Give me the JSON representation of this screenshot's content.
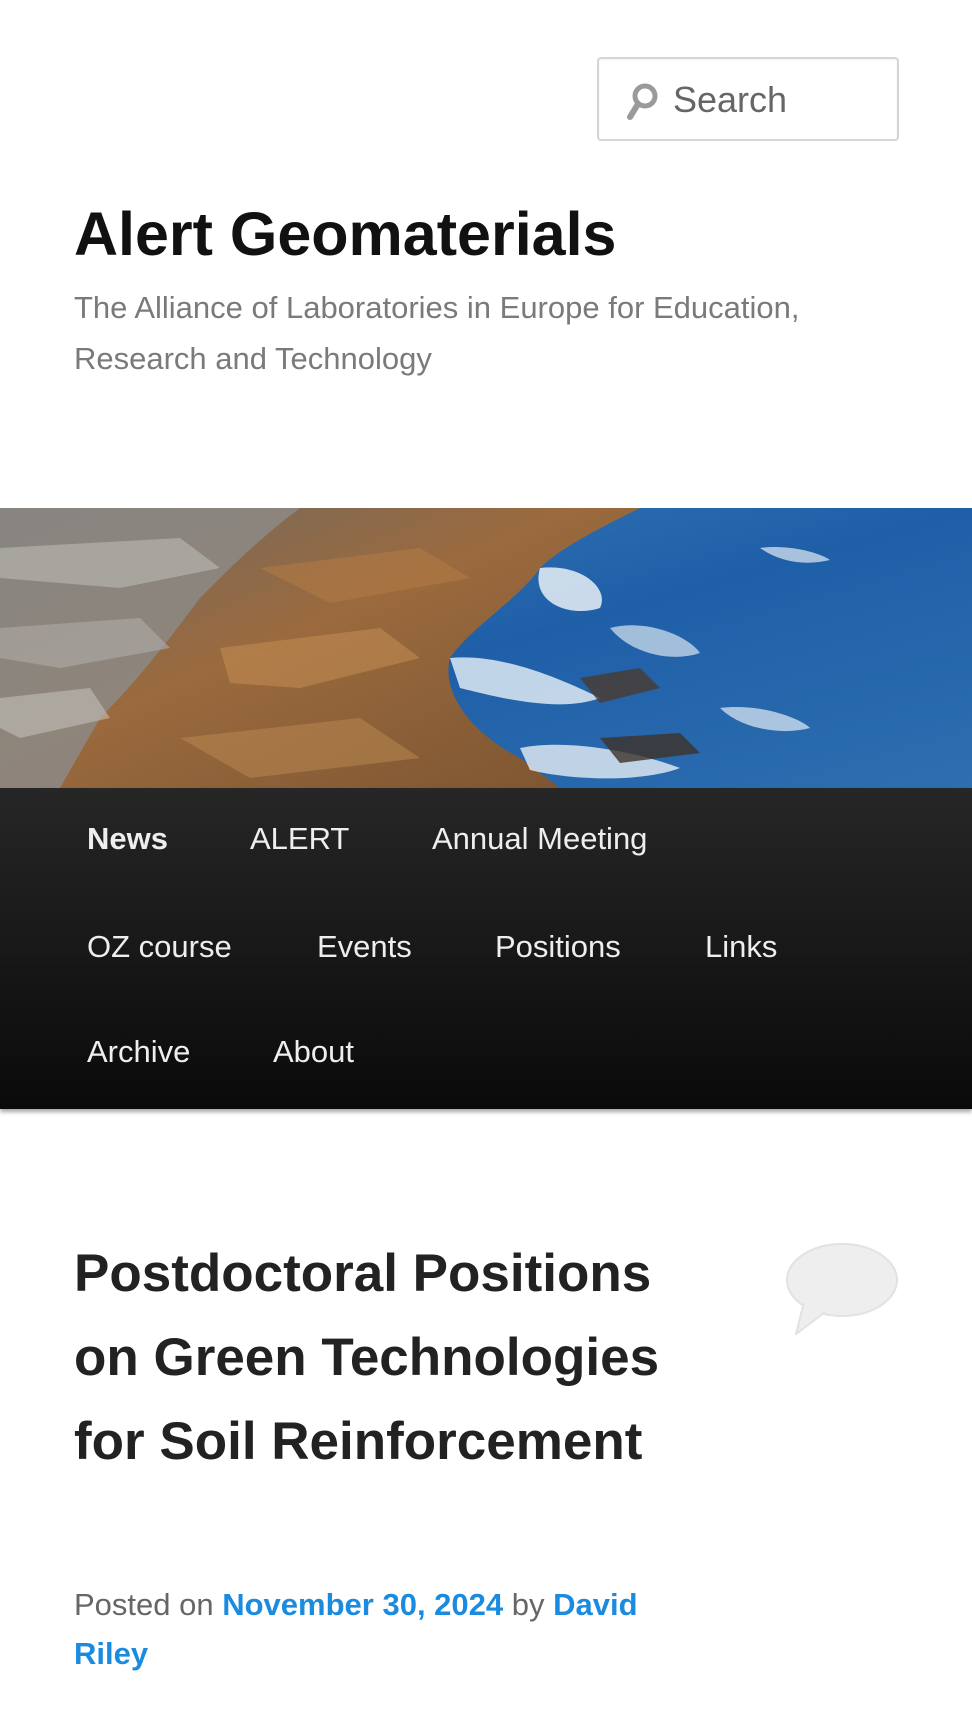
{
  "search": {
    "placeholder": "Search"
  },
  "site": {
    "title": "Alert Geomaterials",
    "description": "The Alliance of Laboratories in Europe for Education, Research and Technology"
  },
  "nav": {
    "items": [
      {
        "label": "News",
        "current": true
      },
      {
        "label": "ALERT"
      },
      {
        "label": "Annual Meeting"
      },
      {
        "label": "OZ course"
      },
      {
        "label": "Events"
      },
      {
        "label": "Positions"
      },
      {
        "label": "Links"
      },
      {
        "label": "Archive"
      },
      {
        "label": "About"
      }
    ]
  },
  "post": {
    "title": "Postdoctoral Positions on Green Technologies for Soil Reinforcement",
    "posted_on_label": "Posted on",
    "date": "November 30, 2024",
    "by_label": "by",
    "author": "David Riley",
    "comment_icon": "comment-bubble-icon"
  },
  "colors": {
    "link": "#1b8be0",
    "nav_background": "#1a1a1a",
    "title": "#111111",
    "description": "#7a7a7a"
  }
}
